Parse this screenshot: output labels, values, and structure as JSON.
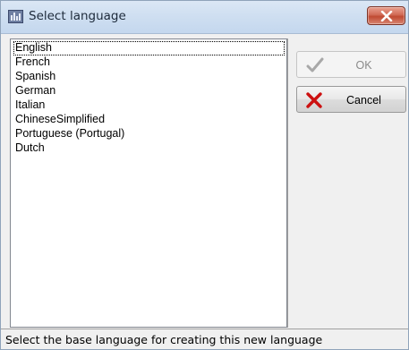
{
  "window": {
    "title": "Select language",
    "app_icon": "app-icon",
    "close_icon": "close-icon"
  },
  "languages": {
    "selected_index": 0,
    "items": [
      "English",
      "French",
      "Spanish",
      "German",
      "Italian",
      "ChineseSimplified",
      "Portuguese (Portugal)",
      "Dutch"
    ]
  },
  "buttons": {
    "ok": {
      "label": "OK",
      "icon": "checkmark-icon",
      "enabled": false
    },
    "cancel": {
      "label": "Cancel",
      "icon": "x-mark-icon",
      "enabled": true
    }
  },
  "status": {
    "text": "Select the base language for creating this new language"
  },
  "colors": {
    "cancel_icon": "#cc1010",
    "ok_icon_disabled": "#a8a8a8",
    "close_button": "#c9523c"
  }
}
